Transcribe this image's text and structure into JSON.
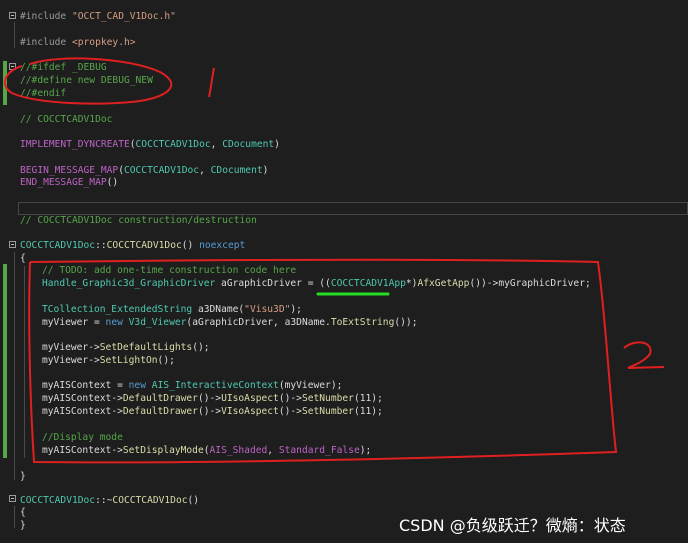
{
  "colors": {
    "background": "#1e1e1e",
    "comment": "#57a64a",
    "keyword": "#569cd6",
    "string": "#d69d85",
    "type": "#4ec9b0",
    "function": "#dcdcaa",
    "annotation_red": "#e02020",
    "highlight_green": "#22dd22"
  },
  "code": {
    "l01": {
      "a": "#include ",
      "b": "\"OCCT_CAD_V1Doc.h\""
    },
    "l02": {
      "a": "#include ",
      "b": "<propkey.h>"
    },
    "l03": {
      "a": "//#ifdef _DEBUG"
    },
    "l04": {
      "a": "//#define new DEBUG_NEW"
    },
    "l05": {
      "a": "//#endif"
    },
    "l06": {
      "a": "// COCCTCADV1Doc"
    },
    "l07": {
      "a": "IMPLEMENT_DYNCREATE",
      "b": "(",
      "c": "COCCTCADV1Doc",
      ".": ", ",
      "d": "CDocument",
      "e": ")"
    },
    "l08": {
      "a": "BEGIN_MESSAGE_MAP",
      "b": "(",
      "c": "COCCTCADV1Doc",
      ".": ", ",
      "d": "CDocument",
      "e": ")"
    },
    "l09": {
      "a": "END_MESSAGE_MAP",
      "b": "()"
    },
    "l10": {
      "a": "// COCCTCADV1Doc construction/destruction"
    },
    "l11": {
      "a": "COCCTCADV1Doc",
      "b": "::",
      "c": "COCCTCADV1Doc",
      "d": "() ",
      "e": "noexcept"
    },
    "l12": {
      "a": "{"
    },
    "l13": {
      "a": "// TODO: add one-time construction code here"
    },
    "l14": {
      "a": "Handle_Graphic3d_GraphicDriver",
      "b": " aGraphicDriver = ((",
      "c": "COCCTCADV1App",
      "d": "*)",
      "e": "AfxGetApp",
      "f": "())->",
      "g": "myGraphicDriver",
      ";": ";"
    },
    "l15": {
      "a": "TCollection_ExtendedString",
      "b": " a3DName(",
      "c": "\"Visu3D\"",
      "d": ");"
    },
    "l16": {
      "a": "myViewer",
      " =": " = ",
      "b": "new ",
      "c": "V3d_Viewer",
      "d": "(aGraphicDriver, a3DName.",
      "e": "ToExtString",
      "f": "());"
    },
    "l17": {
      "a": "myViewer",
      "b": "->",
      "c": "SetDefaultLights",
      "d": "();"
    },
    "l18": {
      "a": "myViewer",
      "b": "->",
      "c": "SetLightOn",
      "d": "();"
    },
    "l19": {
      "a": "myAISContext",
      " =": " = ",
      "b": "new ",
      "c": "AIS_InteractiveContext",
      "d": "(",
      "e": "myViewer",
      "f": ");"
    },
    "l20": {
      "a": "myAISContext",
      "b": "->",
      "c": "DefaultDrawer",
      "d": "()->",
      "e": "UIsoAspect",
      "f": "()->",
      "g": "SetNumber",
      "h": "(11);"
    },
    "l21": {
      "a": "myAISContext",
      "b": "->",
      "c": "DefaultDrawer",
      "d": "()->",
      "e": "VIsoAspect",
      "f": "()->",
      "g": "SetNumber",
      "h": "(11);"
    },
    "l22": {
      "a": "//Display mode"
    },
    "l23": {
      "a": "myAISContext",
      "b": "->",
      "c": "SetDisplayMode",
      "d": "(",
      "e": "AIS_Shaded",
      ".": ", ",
      "f": "Standard_False",
      "g": ");"
    },
    "l24": {
      "a": "}"
    },
    "l25": {
      "a": "COCCTCADV1Doc",
      "b": "::~",
      "c": "COCCTCADV1Doc",
      "d": "()"
    },
    "l26": {
      "a": "{"
    },
    "l27": {
      "a": "}"
    }
  },
  "annotations": {
    "mark_1": "1",
    "mark_2": "2"
  },
  "watermark": "CSDN @负级跃迁？微熵：状态"
}
